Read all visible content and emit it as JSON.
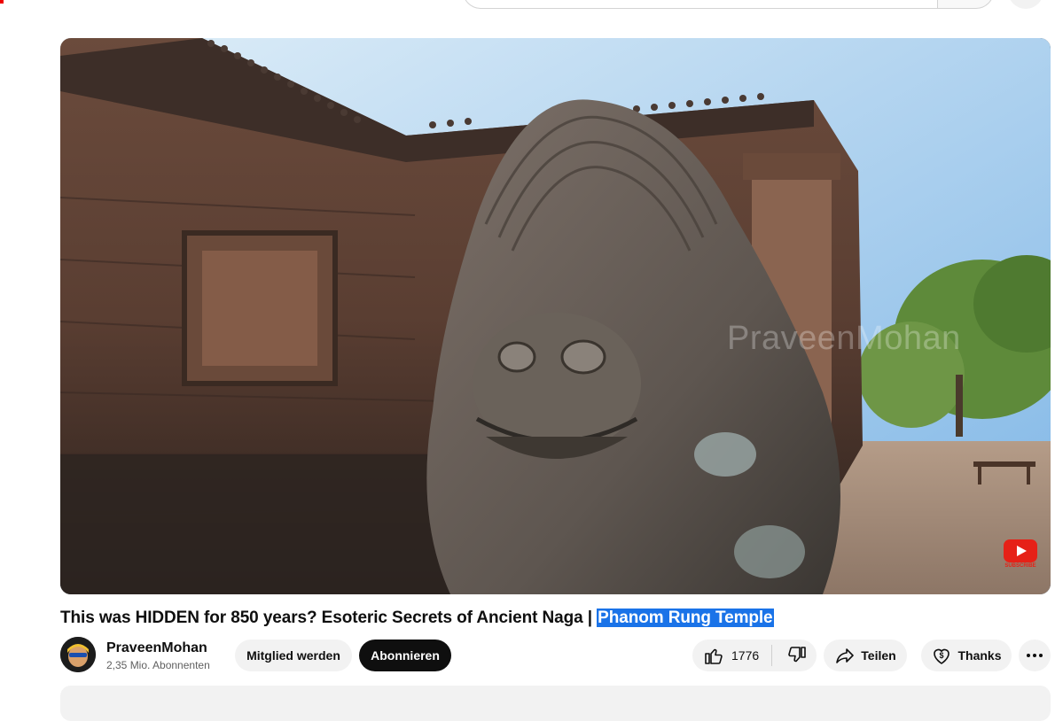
{
  "video": {
    "title_main": "This was HIDDEN for 850 years? Esoteric Secrets of Ancient Naga | ",
    "title_highlight": "Phanom Rung Temple",
    "watermark": "PraveenMohan",
    "subscribe_badge": "SUBSCRIBE"
  },
  "channel": {
    "name": "PraveenMohan",
    "subscribers": "2,35 Mio. Abonnenten"
  },
  "actions": {
    "join_label": "Mitglied werden",
    "subscribe_label": "Abonnieren",
    "like_count": "1776",
    "share_label": "Teilen",
    "thanks_label": "Thanks",
    "more_icon": "more-vert-icon",
    "like_icon": "thumbs-up-icon",
    "dislike_icon": "thumbs-down-icon",
    "share_icon": "share-arrow-icon",
    "thanks_icon": "dollar-heart-icon"
  },
  "colors": {
    "highlight": "#1a73e8",
    "subscribe_bg": "#0f0f0f",
    "pill_bg": "#f2f2f2"
  }
}
